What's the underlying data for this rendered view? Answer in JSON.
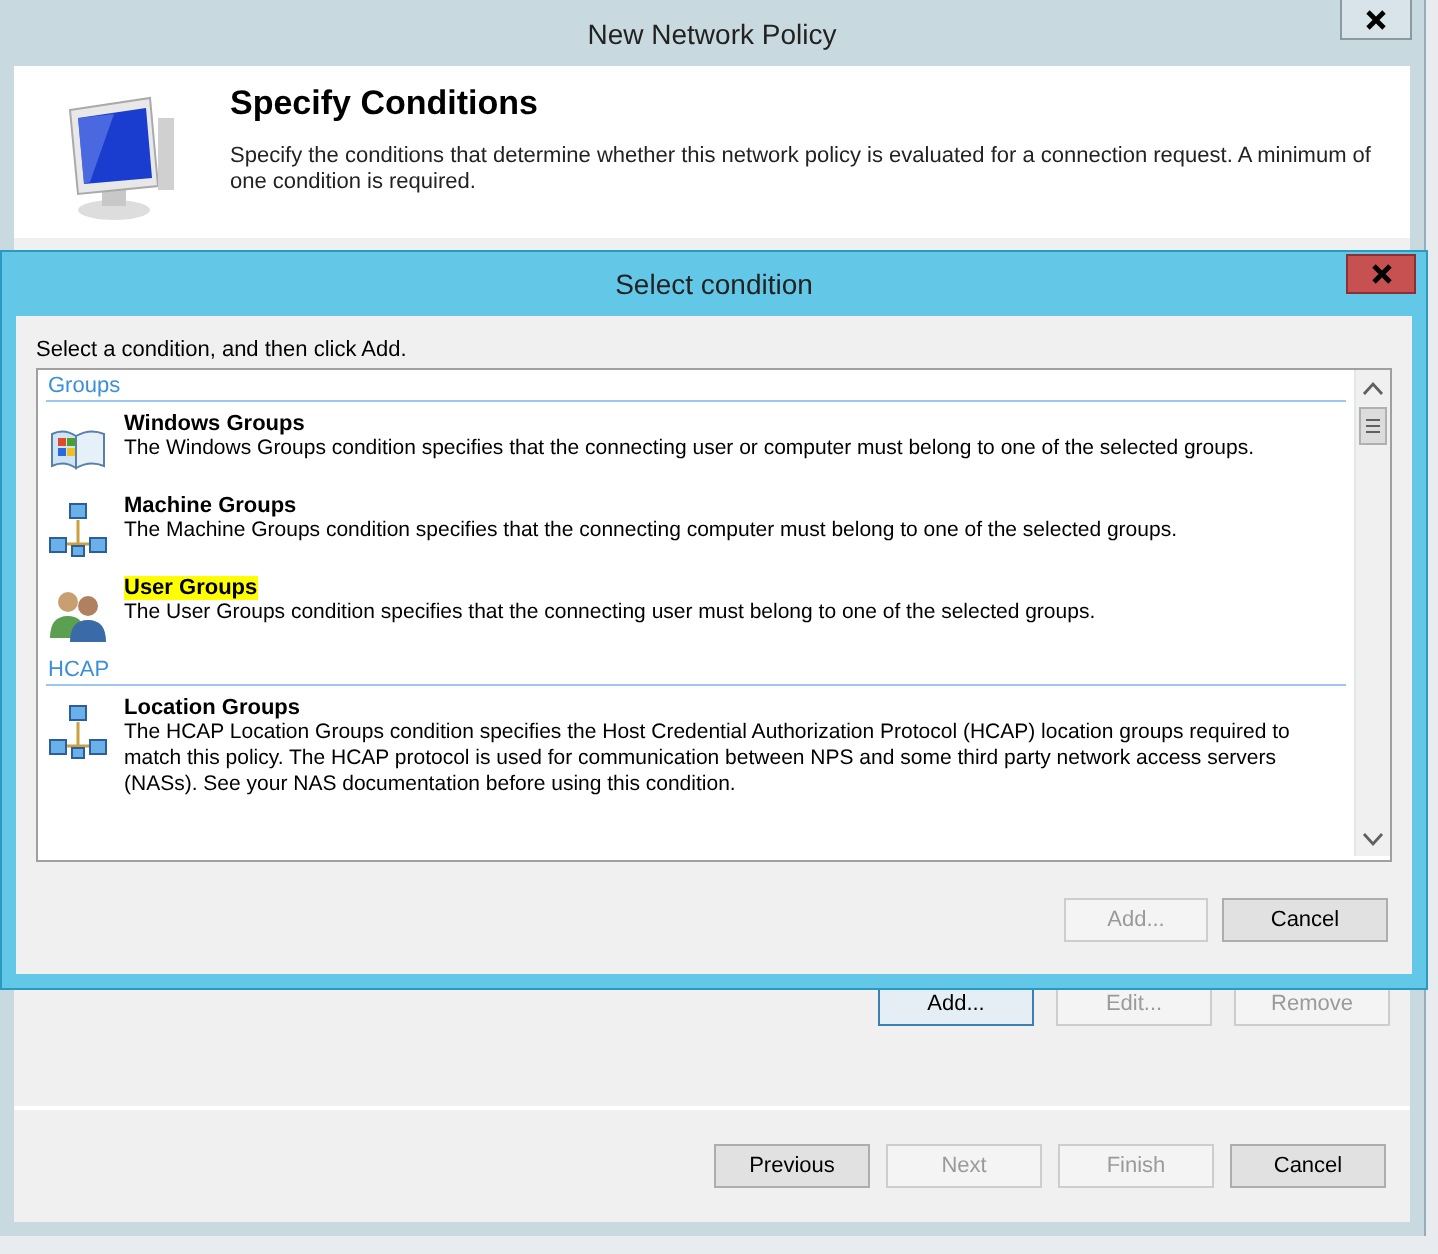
{
  "window": {
    "title": "New Network Policy",
    "header": {
      "title": "Specify Conditions",
      "description": "Specify the conditions that determine whether this network policy is evaluated for a connection request. A minimum of one condition is required."
    },
    "condition_buttons": [
      {
        "label": "Add...",
        "disabled": false,
        "focused": true
      },
      {
        "label": "Edit...",
        "disabled": true,
        "focused": false
      },
      {
        "label": "Remove",
        "disabled": true,
        "focused": false
      }
    ],
    "wizard_buttons": [
      {
        "label": "Previous",
        "disabled": false
      },
      {
        "label": "Next",
        "disabled": true
      },
      {
        "label": "Finish",
        "disabled": true
      },
      {
        "label": "Cancel",
        "disabled": false
      }
    ]
  },
  "dialog": {
    "title": "Select condition",
    "instruction": "Select a condition, and then click Add.",
    "groups": [
      {
        "name": "Groups",
        "conditions": [
          {
            "name": "Windows Groups",
            "kind": "windows",
            "highlighted": false,
            "description": "The Windows Groups condition specifies that the connecting user or computer must belong to one of the selected groups."
          },
          {
            "name": "Machine Groups",
            "kind": "network",
            "highlighted": false,
            "description": "The Machine Groups condition specifies that the connecting computer must belong to one of the selected groups."
          },
          {
            "name": "User Groups",
            "kind": "users",
            "highlighted": true,
            "description": "The User Groups condition specifies that the connecting user must belong to one of the selected groups."
          }
        ]
      },
      {
        "name": "HCAP",
        "conditions": [
          {
            "name": "Location Groups",
            "kind": "network",
            "highlighted": false,
            "description": "The HCAP Location Groups condition specifies the Host Credential Authorization Protocol (HCAP) location groups required to match this policy. The HCAP protocol is used for communication between NPS and some third party network access servers (NASs). See your NAS documentation before using this condition."
          }
        ]
      }
    ],
    "buttons": [
      {
        "label": "Add...",
        "disabled": true
      },
      {
        "label": "Cancel",
        "disabled": false
      }
    ]
  }
}
